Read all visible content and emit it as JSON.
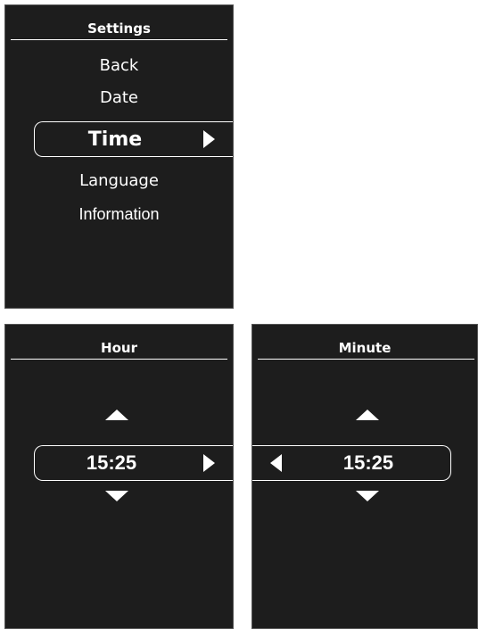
{
  "settings": {
    "title": "Settings",
    "items": [
      "Back",
      "Date",
      "Time",
      "Language",
      "Information"
    ],
    "selected": "Time"
  },
  "hour_screen": {
    "title": "Hour",
    "value": "15:25"
  },
  "minute_screen": {
    "title": "Minute",
    "value": "15:25"
  },
  "colors": {
    "screen_bg": "#1d1d1d",
    "text": "#ffffff",
    "page_bg": "#ffffff"
  },
  "icons": [
    "arrow-right-icon",
    "arrow-left-icon",
    "arrow-up-icon",
    "arrow-down-icon"
  ]
}
